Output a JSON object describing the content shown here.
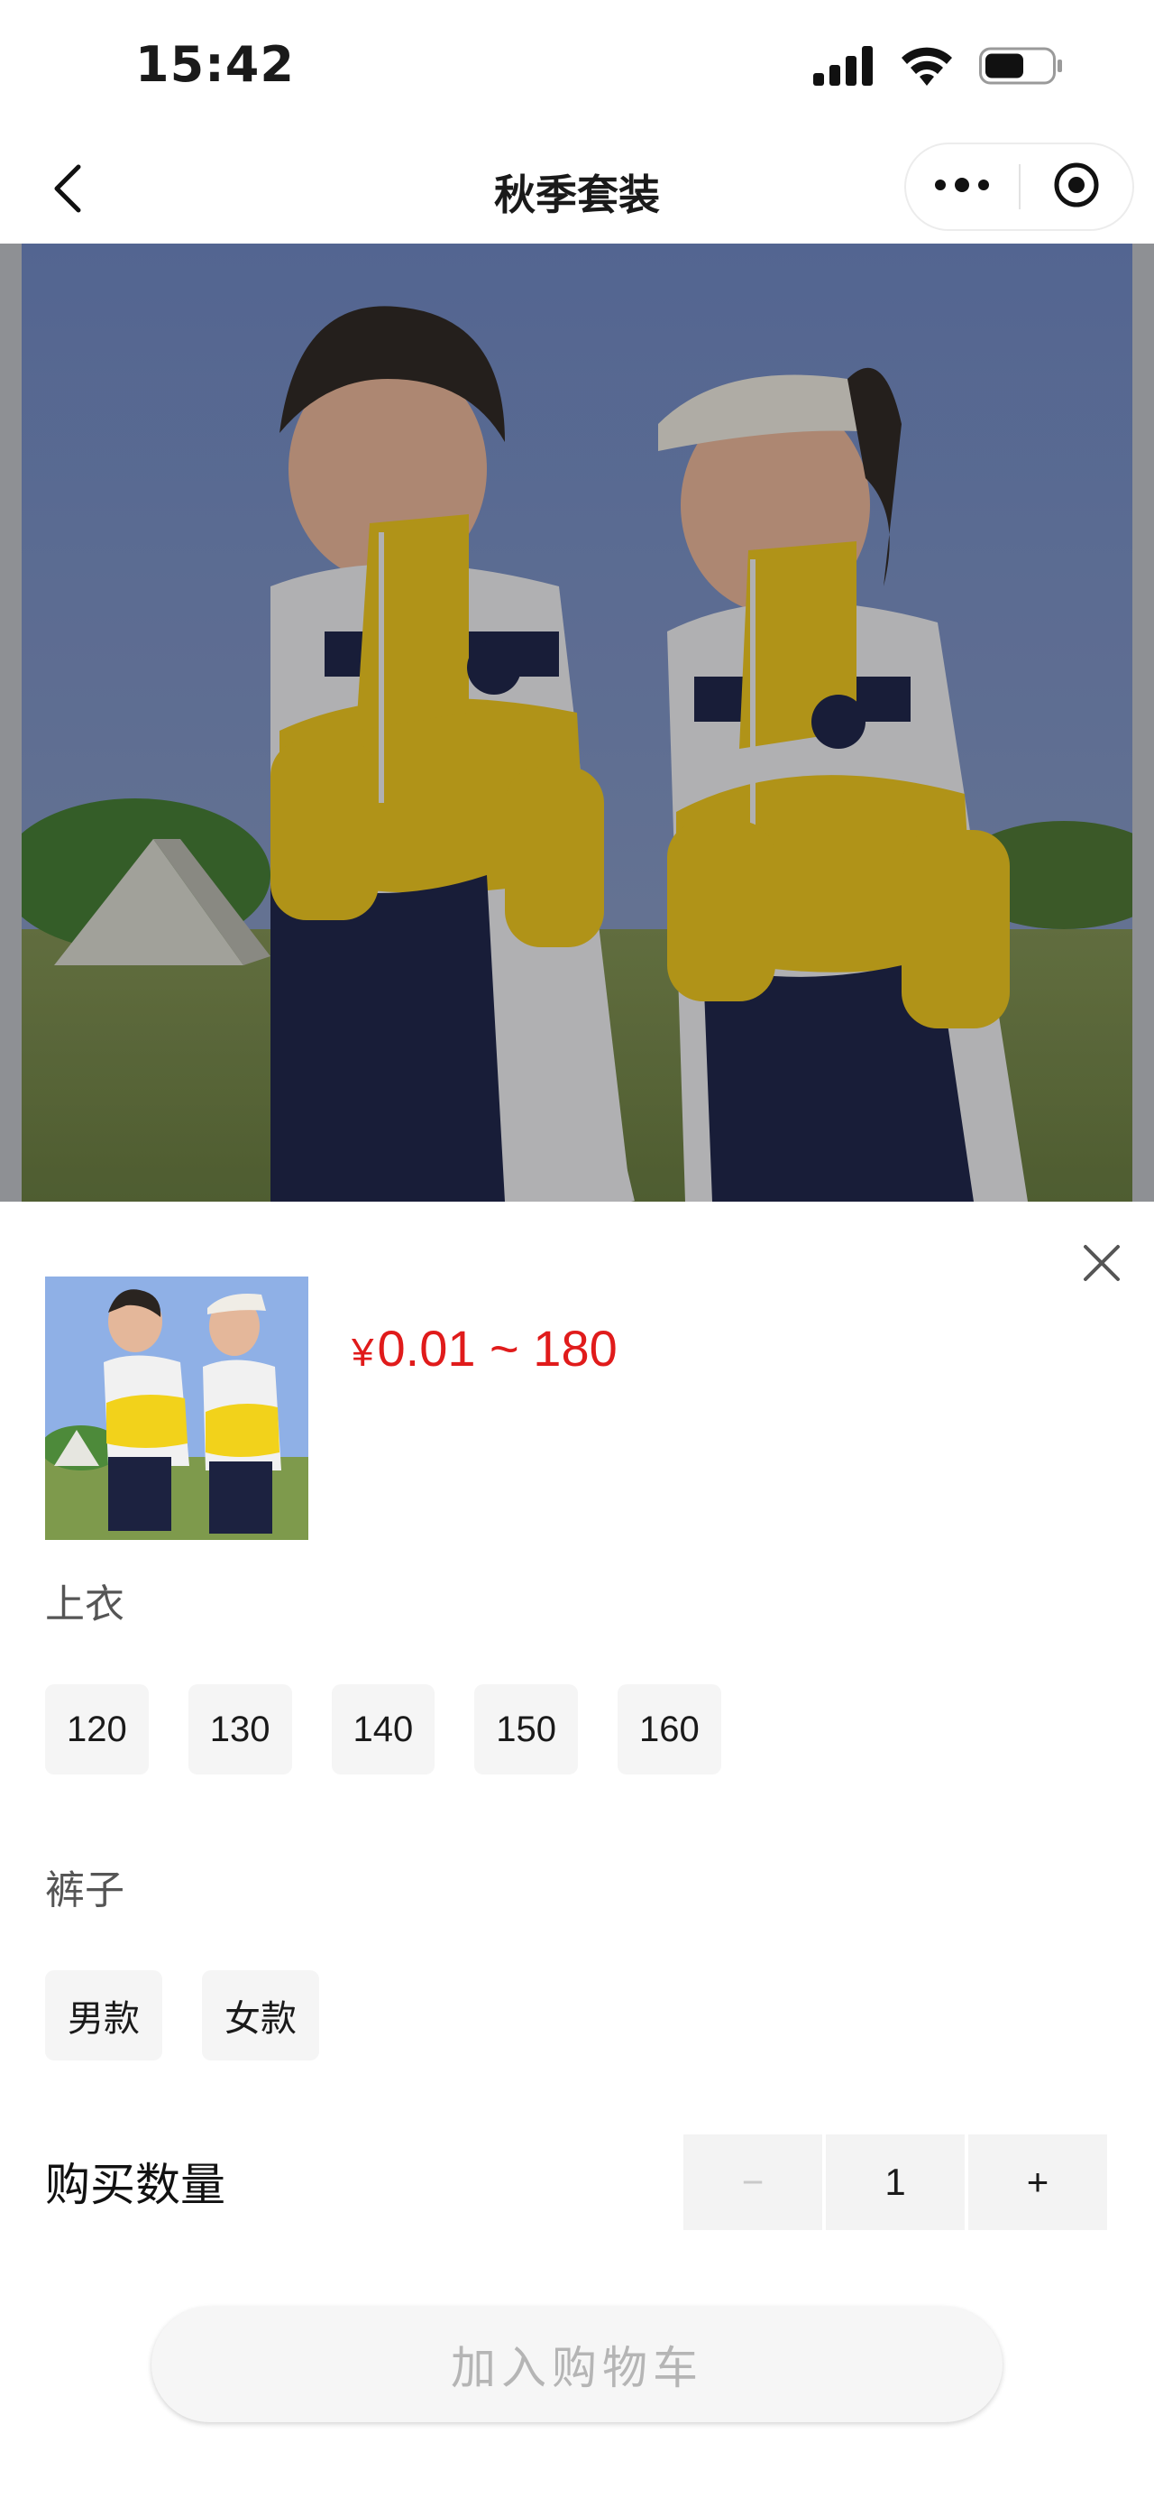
{
  "status_bar": {
    "time": "15:42",
    "icons": [
      "signal-icon",
      "wifi-icon",
      "battery-icon"
    ]
  },
  "nav": {
    "title": "秋季套装",
    "back_icon": "chevron-left-icon",
    "more_icon": "more-dots-icon",
    "target_icon": "target-icon"
  },
  "product": {
    "hero_image": "two children in yellow, white and navy school uniforms on a grass field",
    "price_symbol": "¥",
    "price_range": "0.01 ~ 180"
  },
  "options": {
    "top_label": "上衣",
    "top_sizes": [
      "120",
      "130",
      "140",
      "150",
      "160"
    ],
    "pants_label": "裤子",
    "pants_styles": [
      "男款",
      "女款"
    ]
  },
  "quantity": {
    "label": "购买数量",
    "value": "1",
    "minus": "−",
    "plus": "+"
  },
  "cart_button": {
    "label": "加入购物车"
  },
  "colors": {
    "price": "#e01b1b",
    "option_bg": "#f5f5f5",
    "disabled_text": "#b5b5b5"
  }
}
